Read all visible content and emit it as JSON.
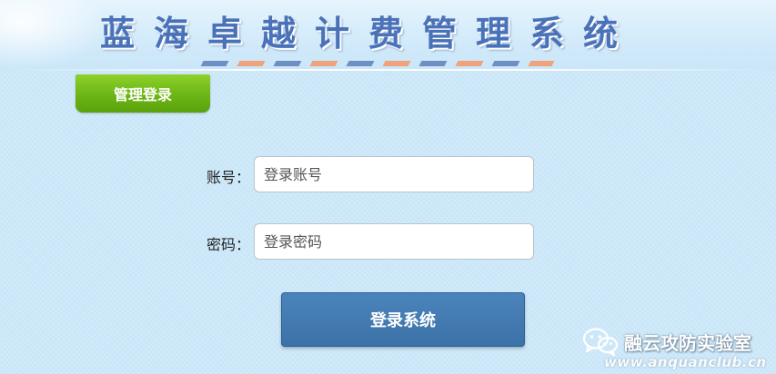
{
  "header": {
    "site_title": "蓝海卓越计费管理系统"
  },
  "tabs": {
    "admin_login": "管理登录"
  },
  "form": {
    "account_label": "账号：",
    "account_placeholder": "登录账号",
    "password_label": "密码：",
    "password_placeholder": "登录密码",
    "submit_label": "登录系统"
  },
  "watermark": {
    "name": "融云攻防实验室",
    "url": "www.anquanclub.cn",
    "logo_icon": "wechat-icon"
  },
  "colors": {
    "background": "#c9e6f8",
    "title": "#4a72b8",
    "tab_green": "#6cb515",
    "button_blue": "#3b72a8"
  }
}
